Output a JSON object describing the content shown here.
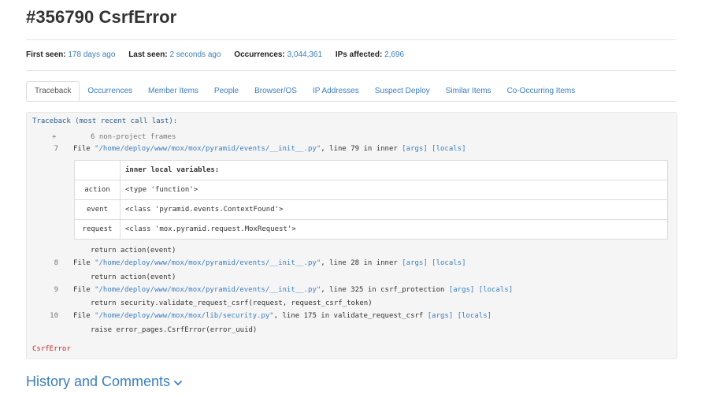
{
  "page_title": "#356790 CsrfError",
  "meta": {
    "first_seen_label": "First seen:",
    "first_seen_value": "178 days ago",
    "last_seen_label": "Last seen:",
    "last_seen_value": "2 seconds ago",
    "occurrences_label": "Occurrences:",
    "occurrences_value": "3,044,361",
    "ips_label": "IPs affected:",
    "ips_value": "2,696"
  },
  "tabs": [
    {
      "label": "Traceback",
      "active": true
    },
    {
      "label": "Occurrences"
    },
    {
      "label": "Member Items"
    },
    {
      "label": "People"
    },
    {
      "label": "Browser/OS"
    },
    {
      "label": "IP Addresses"
    },
    {
      "label": "Suspect Deploy"
    },
    {
      "label": "Similar Items"
    },
    {
      "label": "Co-Occurring Items"
    }
  ],
  "traceback": {
    "header": "Traceback (most recent call last):",
    "expand_symbol": "+",
    "non_project": "6 non-project frames",
    "frames": [
      {
        "num": "7",
        "file_prefix": "File ",
        "path": "\"/home/deploy/www/mox/mox/pyramid/events/__init__.py\"",
        "rest": ", line 79 in inner ",
        "args": "[args]",
        "locals": "[locals]"
      },
      {
        "num": "8",
        "file_prefix": "File ",
        "path": "\"/home/deploy/www/mox/mox/pyramid/events/__init__.py\"",
        "rest": ", line 28 in inner ",
        "args": "[args]",
        "locals": "[locals]",
        "code_before": "return action(event)"
      },
      {
        "num": "9",
        "file_prefix": "File ",
        "path": "\"/home/deploy/www/mox/mox/pyramid/events/__init__.py\"",
        "rest": ", line 325 in csrf_protection ",
        "args": "[args]",
        "locals": "[locals]",
        "code_before": "return action(event)"
      },
      {
        "num": "10",
        "file_prefix": "File ",
        "path": "\"/home/deploy/www/mox/mox/lib/security.py\"",
        "rest": ", line 175 in validate_request_csrf ",
        "args": "[args]",
        "locals": "[locals]",
        "code_before": "return security.validate_request_csrf(request, request_csrf_token)"
      }
    ],
    "final_code": "raise error_pages.CsrfError(error_uuid)",
    "locals_table": {
      "title": "inner local variables:",
      "rows": [
        {
          "key": "action",
          "value": "<type 'function'>"
        },
        {
          "key": "event",
          "value": "<class 'pyramid.events.ContextFound'>"
        },
        {
          "key": "request",
          "value": "<class 'mox.pyramid.request.MoxRequest'>"
        }
      ]
    },
    "error_name": "CsrfError"
  },
  "history": {
    "label": "History and Comments",
    "chevron": "⌄"
  }
}
